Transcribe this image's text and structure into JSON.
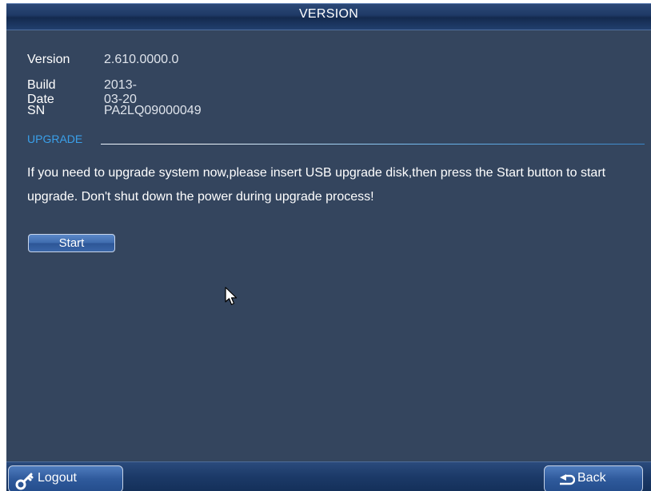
{
  "window": {
    "title": "VERSION"
  },
  "info": {
    "version": {
      "label": "Version",
      "value": "2.610.0000.0"
    },
    "build_date": {
      "label": "Build Date",
      "value": "2013-03-20"
    },
    "sn": {
      "label": "SN",
      "value": "PA2LQ09000049"
    }
  },
  "upgrade": {
    "section_title": "UPGRADE",
    "message": "If you need to upgrade system now,please insert USB upgrade disk,then press the Start button to start upgrade. Don't shut down the power during upgrade process!",
    "start_label": "Start"
  },
  "footer": {
    "logout_label": "Logout",
    "logout_icon": "key-icon",
    "back_label": "Back",
    "back_icon": "back-arrow-icon"
  },
  "colors": {
    "background": "#34455e",
    "title_bar": "#1f3a66",
    "section_accent": "#3aa0ea",
    "text": "#ffffff"
  }
}
